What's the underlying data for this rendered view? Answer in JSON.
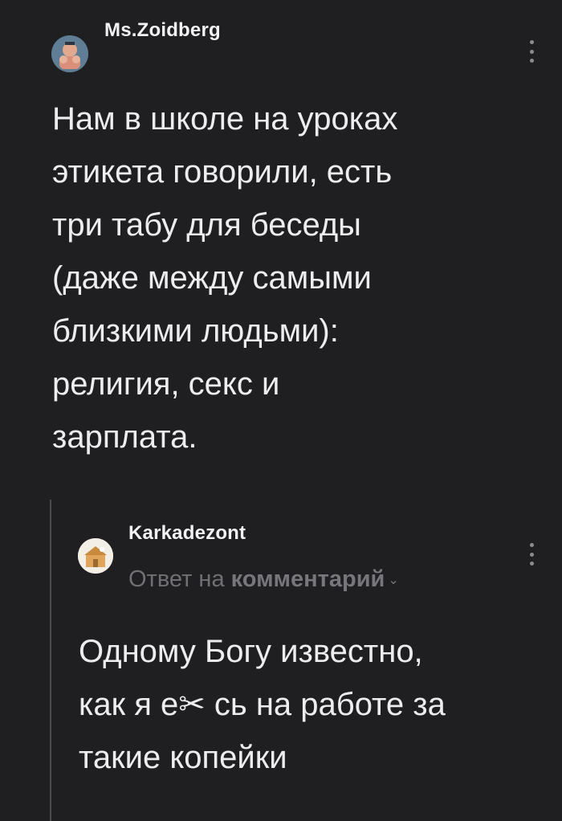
{
  "comment": {
    "username": "Ms.Zoidberg",
    "avatar": "avatar-cartoon-icon",
    "text": "Нам в школе на уроках\nэтикета говорили, есть\nтри табу для беседы\n(даже между самыми\nблизкими людьми):\nрелигия, секс и\nзарплата."
  },
  "reply": {
    "username": "Karkadezont",
    "avatar": "avatar-house-icon",
    "reply_prefix": "Ответ на",
    "reply_ref": "комментарий",
    "text": "Одному Богу известно,\nкак я е✂ сь на работе за\nтакие копейки"
  },
  "colors": {
    "background": "#1f1f22",
    "text": "#ededee",
    "muted": "#6f6f74"
  }
}
